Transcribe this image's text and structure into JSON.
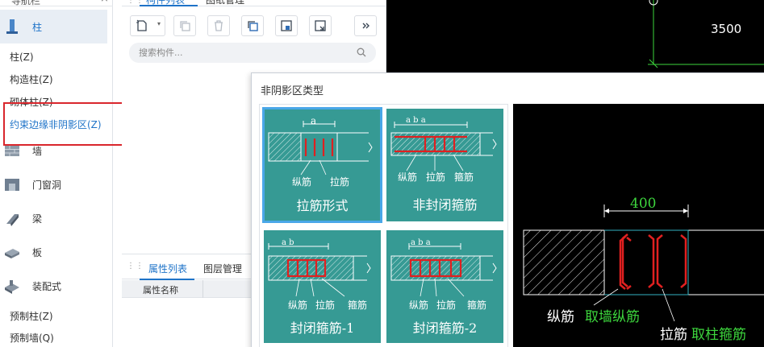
{
  "nav": {
    "header_label": "导航栏",
    "categories": [
      {
        "label": "柱"
      },
      {
        "label": "墙"
      },
      {
        "label": "门窗洞"
      },
      {
        "label": "梁"
      },
      {
        "label": "板"
      },
      {
        "label": "装配式"
      }
    ],
    "column_items": [
      "柱(Z)",
      "构造柱(Z)",
      "砌体柱(Z)",
      "约束边缘非阴影区(Z)"
    ],
    "prefab_items": [
      "预制柱(Z)",
      "预制墙(Q)"
    ]
  },
  "mid": {
    "tab_component_list": "构件列表",
    "tab_drawing_manage": "图纸管理",
    "search_placeholder": "搜索构件...",
    "tab_property_list": "属性列表",
    "tab_layer_manage": "图层管理",
    "property_col_name": "属性名称"
  },
  "cad": {
    "dimension": "3500"
  },
  "dialog": {
    "title": "非阴影区类型",
    "options": [
      {
        "label": "拉筋形式",
        "dim": "a",
        "sub1": "纵筋",
        "sub2": "拉筋"
      },
      {
        "label": "非封闭箍筋",
        "dim": "a  b  a",
        "sub1": "纵筋",
        "sub2": "拉筋",
        "sub3": "箍筋"
      },
      {
        "label": "封闭箍筋-1",
        "dim": "a  b",
        "sub1": "纵筋",
        "sub2": "拉筋",
        "sub3": "箍筋"
      },
      {
        "label": "封闭箍筋-2",
        "dim": "a  b  a",
        "sub1": "纵筋",
        "sub2": "拉筋",
        "sub3": "箍筋"
      }
    ],
    "preview": {
      "dimension": "400",
      "label_longbar": "纵筋",
      "label_longbar_source": "取墙纵筋",
      "label_tiebar": "拉筋",
      "label_tiebar_source": "取柱箍筋"
    }
  },
  "colors": {
    "accent": "#1e73c8",
    "option_bg": "#369a94",
    "highlight": "#d9262c",
    "cad_green": "#3dd63d"
  }
}
